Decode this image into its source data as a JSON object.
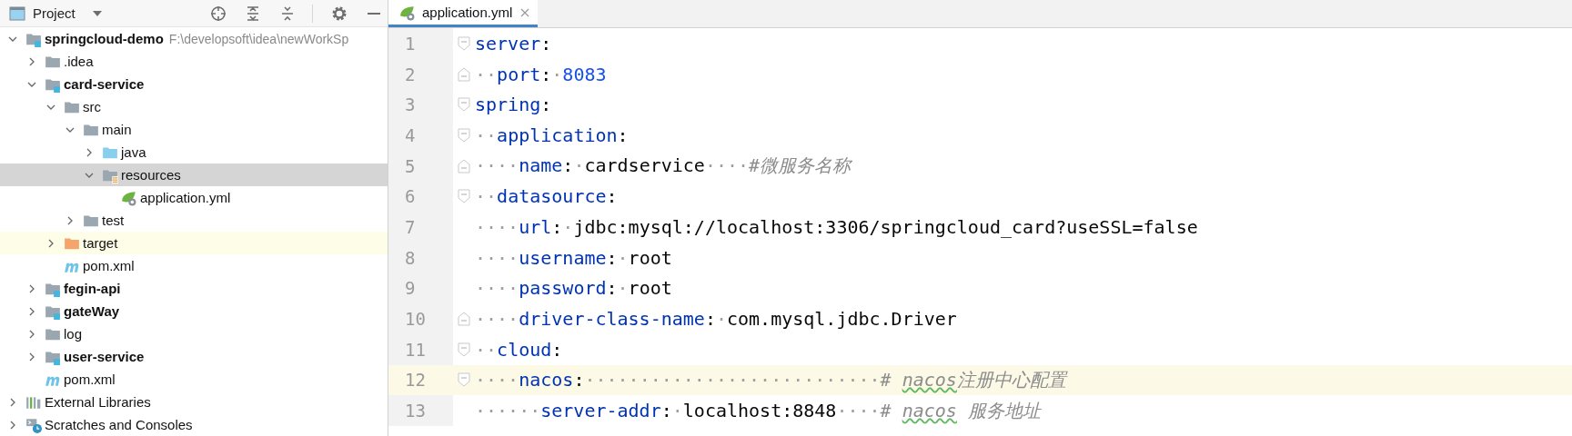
{
  "project_panel": {
    "title": "Project",
    "tree": [
      {
        "label": "springcloud-demo",
        "hint": "F:\\developsoft\\idea\\newWorkSp",
        "kind": "module",
        "bold": true,
        "expanded": true,
        "selected": false,
        "highlighted": false,
        "children": [
          {
            "label": ".idea",
            "kind": "folder",
            "bold": false,
            "expanded": false,
            "selected": false,
            "highlighted": false
          },
          {
            "label": "card-service",
            "kind": "module",
            "bold": true,
            "expanded": true,
            "selected": false,
            "highlighted": false,
            "children": [
              {
                "label": "src",
                "kind": "folder",
                "bold": false,
                "expanded": true,
                "selected": false,
                "highlighted": false,
                "children": [
                  {
                    "label": "main",
                    "kind": "folder",
                    "bold": false,
                    "expanded": true,
                    "selected": false,
                    "highlighted": false,
                    "children": [
                      {
                        "label": "java",
                        "kind": "source_folder",
                        "bold": false,
                        "expanded": false,
                        "selected": false,
                        "highlighted": false
                      },
                      {
                        "label": "resources",
                        "kind": "resources_folder",
                        "bold": false,
                        "expanded": true,
                        "selected": true,
                        "highlighted": false,
                        "children": [
                          {
                            "label": "application.yml",
                            "kind": "spring_yaml",
                            "bold": false,
                            "selected": false,
                            "highlighted": false
                          }
                        ]
                      }
                    ]
                  },
                  {
                    "label": "test",
                    "kind": "folder",
                    "bold": false,
                    "expanded": false,
                    "selected": false,
                    "highlighted": false
                  }
                ]
              },
              {
                "label": "target",
                "kind": "excluded_folder",
                "bold": false,
                "expanded": false,
                "selected": false,
                "highlighted": true
              },
              {
                "label": "pom.xml",
                "kind": "maven",
                "bold": false,
                "selected": false,
                "highlighted": false
              }
            ]
          },
          {
            "label": "fegin-api",
            "kind": "module",
            "bold": true,
            "expanded": false,
            "selected": false,
            "highlighted": false
          },
          {
            "label": "gateWay",
            "kind": "module",
            "bold": true,
            "expanded": false,
            "selected": false,
            "highlighted": false
          },
          {
            "label": "log",
            "kind": "folder",
            "bold": false,
            "expanded": false,
            "selected": false,
            "highlighted": false
          },
          {
            "label": "user-service",
            "kind": "module",
            "bold": true,
            "expanded": false,
            "selected": false,
            "highlighted": false
          },
          {
            "label": "pom.xml",
            "kind": "maven",
            "bold": false,
            "selected": false,
            "highlighted": false
          }
        ]
      },
      {
        "label": "External Libraries",
        "kind": "libraries",
        "bold": false,
        "expanded": false,
        "selected": false,
        "highlighted": false
      },
      {
        "label": "Scratches and Consoles",
        "kind": "scratches",
        "bold": false,
        "expanded": false,
        "selected": false,
        "highlighted": false
      }
    ]
  },
  "editor": {
    "tabs": [
      {
        "label": "application.yml",
        "kind": "spring_yaml",
        "selected": true
      }
    ],
    "lines": [
      {
        "number": "1",
        "fold": {
          "kind": "start"
        },
        "current": false,
        "tokens": [
          {
            "kind": "key",
            "text": "server"
          },
          {
            "kind": "punct",
            "text": ":"
          }
        ]
      },
      {
        "number": "2",
        "fold": {
          "kind": "end"
        },
        "current": false,
        "tokens": [
          {
            "kind": "ws",
            "text": "··"
          },
          {
            "kind": "key",
            "text": "port"
          },
          {
            "kind": "punct",
            "text": ":"
          },
          {
            "kind": "ws",
            "text": "·"
          },
          {
            "kind": "number",
            "text": "8083"
          }
        ]
      },
      {
        "number": "3",
        "fold": {
          "kind": "start"
        },
        "current": false,
        "tokens": [
          {
            "kind": "key",
            "text": "spring"
          },
          {
            "kind": "punct",
            "text": ":"
          }
        ]
      },
      {
        "number": "4",
        "fold": {
          "kind": "start"
        },
        "current": false,
        "tokens": [
          {
            "kind": "ws",
            "text": "··"
          },
          {
            "kind": "key",
            "text": "application"
          },
          {
            "kind": "punct",
            "text": ":"
          }
        ]
      },
      {
        "number": "5",
        "fold": {
          "kind": "end"
        },
        "current": false,
        "tokens": [
          {
            "kind": "ws",
            "text": "····"
          },
          {
            "kind": "key",
            "text": "name"
          },
          {
            "kind": "punct",
            "text": ":"
          },
          {
            "kind": "ws",
            "text": "·"
          },
          {
            "kind": "value",
            "text": "cardservice"
          },
          {
            "kind": "ws",
            "text": "····"
          },
          {
            "kind": "comment",
            "parts": [
              {
                "text": "#微服务名称",
                "flagged": false
              }
            ]
          }
        ]
      },
      {
        "number": "6",
        "fold": {
          "kind": "start"
        },
        "current": false,
        "tokens": [
          {
            "kind": "ws",
            "text": "··"
          },
          {
            "kind": "key",
            "text": "datasource"
          },
          {
            "kind": "punct",
            "text": ":"
          }
        ]
      },
      {
        "number": "7",
        "current": false,
        "tokens": [
          {
            "kind": "ws",
            "text": "····"
          },
          {
            "kind": "key",
            "text": "url"
          },
          {
            "kind": "punct",
            "text": ":"
          },
          {
            "kind": "ws",
            "text": "·"
          },
          {
            "kind": "value",
            "text": "jdbc:mysql://localhost:3306/springcloud_card?useSSL=false"
          }
        ]
      },
      {
        "number": "8",
        "current": false,
        "tokens": [
          {
            "kind": "ws",
            "text": "····"
          },
          {
            "kind": "key",
            "text": "username"
          },
          {
            "kind": "punct",
            "text": ":"
          },
          {
            "kind": "ws",
            "text": "·"
          },
          {
            "kind": "value",
            "text": "root"
          }
        ]
      },
      {
        "number": "9",
        "current": false,
        "tokens": [
          {
            "kind": "ws",
            "text": "····"
          },
          {
            "kind": "key",
            "text": "password"
          },
          {
            "kind": "punct",
            "text": ":"
          },
          {
            "kind": "ws",
            "text": "·"
          },
          {
            "kind": "value",
            "text": "root"
          }
        ]
      },
      {
        "number": "10",
        "fold": {
          "kind": "end"
        },
        "current": false,
        "tokens": [
          {
            "kind": "ws",
            "text": "····"
          },
          {
            "kind": "key",
            "text": "driver-class-name"
          },
          {
            "kind": "punct",
            "text": ":"
          },
          {
            "kind": "ws",
            "text": "·"
          },
          {
            "kind": "value",
            "text": "com.mysql.jdbc.Driver"
          }
        ]
      },
      {
        "number": "11",
        "fold": {
          "kind": "start"
        },
        "current": false,
        "tokens": [
          {
            "kind": "ws",
            "text": "··"
          },
          {
            "kind": "key",
            "text": "cloud"
          },
          {
            "kind": "punct",
            "text": ":"
          }
        ]
      },
      {
        "number": "12",
        "fold": {
          "kind": "start"
        },
        "current": true,
        "tokens": [
          {
            "kind": "ws",
            "text": "····"
          },
          {
            "kind": "key",
            "text": "nacos"
          },
          {
            "kind": "punct",
            "text": ":"
          },
          {
            "kind": "ws",
            "text": "···························"
          },
          {
            "kind": "comment",
            "parts": [
              {
                "text": "# ",
                "flagged": false
              },
              {
                "text": "nacos",
                "flagged": true
              },
              {
                "text": "注册中心配置",
                "flagged": false
              }
            ]
          }
        ]
      },
      {
        "number": "13",
        "current": false,
        "tokens": [
          {
            "kind": "ws",
            "text": "······"
          },
          {
            "kind": "key",
            "text": "server-addr"
          },
          {
            "kind": "punct",
            "text": ":"
          },
          {
            "kind": "ws",
            "text": "·"
          },
          {
            "kind": "value",
            "text": "localhost:8848"
          },
          {
            "kind": "ws",
            "text": "····"
          },
          {
            "kind": "comment",
            "parts": [
              {
                "text": "# ",
                "flagged": false
              },
              {
                "text": "nacos",
                "flagged": true
              },
              {
                "text": " 服务地址",
                "flagged": false
              }
            ]
          }
        ]
      }
    ]
  }
}
